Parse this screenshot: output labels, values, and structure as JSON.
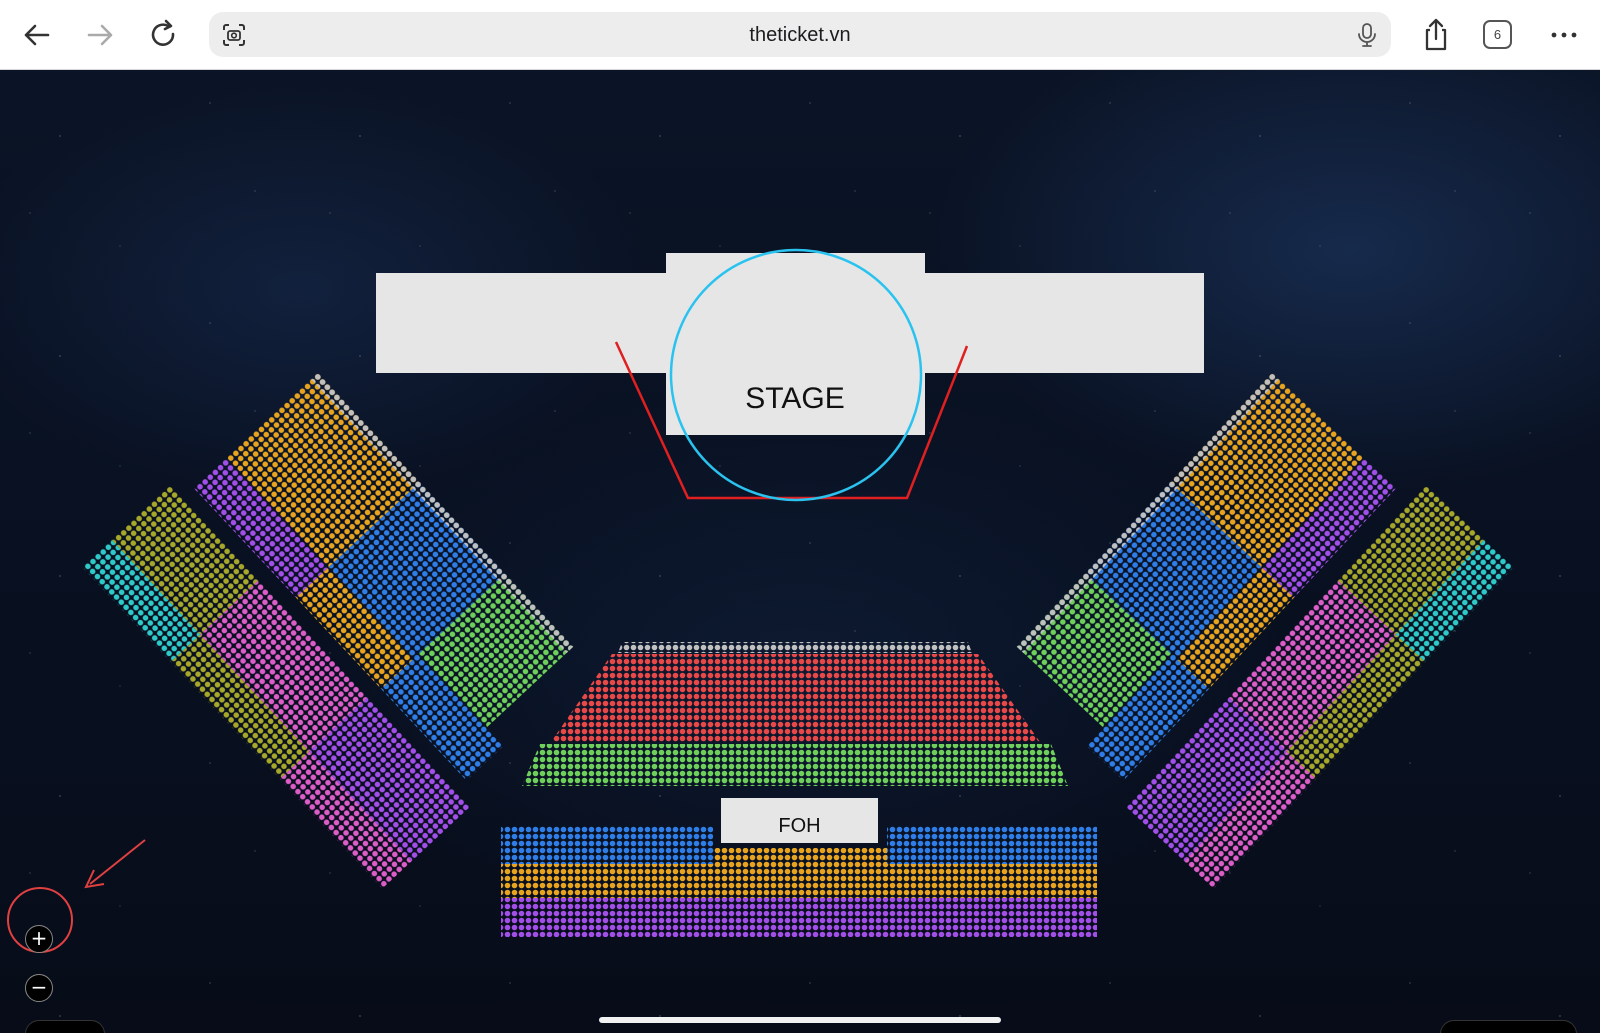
{
  "browser": {
    "url": "theticket.vn",
    "tab_count": "6",
    "icons": [
      "back-arrow-icon",
      "forward-arrow-icon",
      "reload-icon",
      "camera-scan-icon",
      "microphone-icon",
      "share-icon",
      "tabs-icon",
      "more-icon"
    ]
  },
  "venue": {
    "stage_label": "STAGE",
    "foh_label": "FOH"
  },
  "zoom": {
    "in_label": "+",
    "out_label": "−"
  },
  "colors": {
    "stage": "#e6e6e6",
    "stage_circle": "#2ac3f0",
    "catwalk_outline": "#e02020",
    "orange": "#e8a41e",
    "blue": "#2f7ee8",
    "purple": "#a24ee8",
    "green": "#6ed05a",
    "olive": "#a7a72a",
    "cyan": "#2ec9c9",
    "pink": "#dc5cc8",
    "red": "#e84848",
    "gray": "#c0c0c0",
    "annotation": "#e04040"
  },
  "annotation": {
    "target": "zoom-in-button",
    "marker": "red circle with arrow"
  }
}
